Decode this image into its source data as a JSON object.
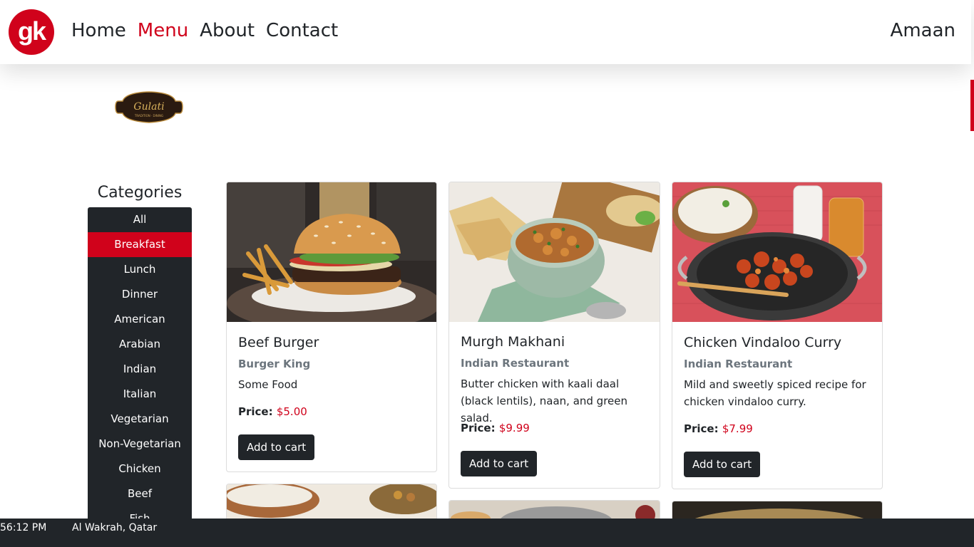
{
  "brand": {
    "logo_text": "gk"
  },
  "nav": {
    "links": [
      "Home",
      "Menu",
      "About",
      "Contact"
    ],
    "active": "Menu",
    "user": "Amaan"
  },
  "restaurant_badge": {
    "name": "Gulati",
    "tagline": "TRADITION · DINING"
  },
  "sidebar": {
    "title": "Categories",
    "items": [
      "All",
      "Breakfast",
      "Lunch",
      "Dinner",
      "American",
      "Arabian",
      "Indian",
      "Italian",
      "Vegetarian",
      "Non-Vegetarian",
      "Chicken",
      "Beef",
      "Fish"
    ],
    "active": "Breakfast"
  },
  "cards": [
    {
      "title": "Beef Burger",
      "restaurant": "Burger King",
      "description": "Some Food",
      "price_label": "Price:",
      "price": "$5.00",
      "button": "Add to cart"
    },
    {
      "title": "Murgh Makhani",
      "restaurant": "Indian Restaurant",
      "description": "Butter chicken with kaali daal (black lentils), naan, and green salad.",
      "price_label": "Price:",
      "price": "$9.99",
      "button": "Add to cart"
    },
    {
      "title": "Chicken Vindaloo Curry",
      "restaurant": "Indian Restaurant",
      "description": "Mild and sweetly spiced recipe for chicken vindaloo curry.",
      "price_label": "Price:",
      "price": "$7.99",
      "button": "Add to cart"
    }
  ],
  "taskbar": {
    "time": "56:12 PM",
    "location": "Al Wakrah, Qatar"
  },
  "colors": {
    "accent": "#d0021b",
    "dark": "#212529",
    "muted": "#6c757d"
  }
}
